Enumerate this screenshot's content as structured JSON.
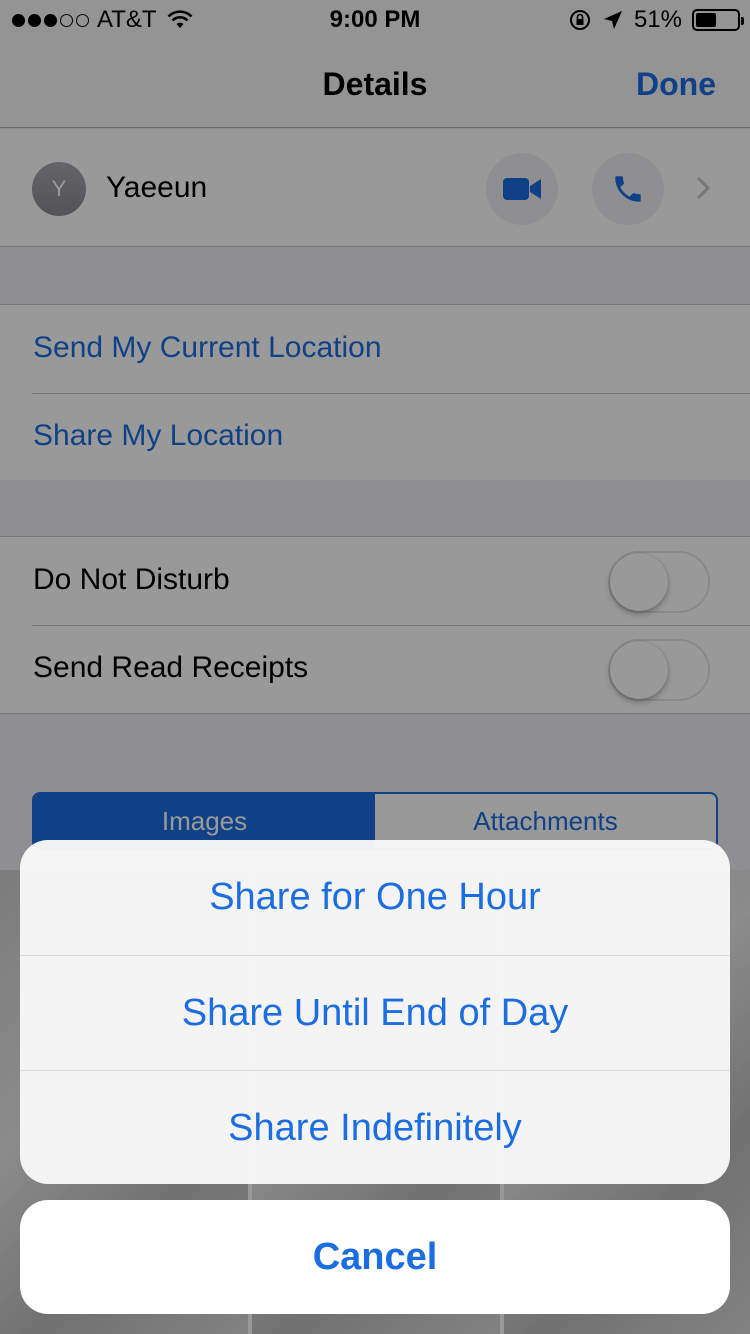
{
  "status_bar": {
    "carrier": "AT&T",
    "time": "9:00 PM",
    "battery_percent": "51%",
    "battery_level": 0.51,
    "signal_bars_filled": 3,
    "signal_bars_total": 5
  },
  "nav": {
    "title": "Details",
    "done_label": "Done"
  },
  "contact": {
    "initial": "Y",
    "name": "Yaeeun"
  },
  "location": {
    "send_current": "Send My Current Location",
    "share": "Share My Location"
  },
  "settings": {
    "do_not_disturb": {
      "label": "Do Not Disturb",
      "on": false
    },
    "read_receipts": {
      "label": "Send Read Receipts",
      "on": false
    }
  },
  "segmented": {
    "images": "Images",
    "attachments": "Attachments",
    "selected": "Images"
  },
  "action_sheet": {
    "options": [
      "Share for One Hour",
      "Share Until End of Day",
      "Share Indefinitely"
    ],
    "cancel": "Cancel"
  },
  "colors": {
    "accent": "#1b6de0",
    "background": "#efeff4"
  }
}
